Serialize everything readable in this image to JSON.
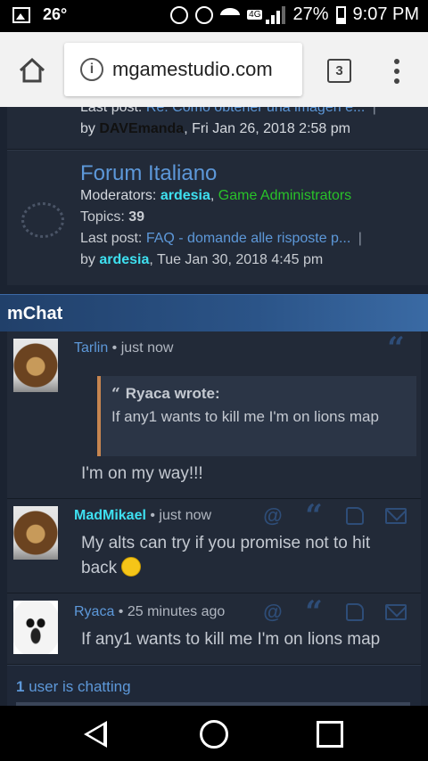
{
  "status_bar": {
    "temperature": "26°",
    "network": "4G",
    "battery": "27%",
    "time": "9:07 PM"
  },
  "browser": {
    "url": "mgamestudio.com",
    "tab_count": "3"
  },
  "forum": {
    "prev_row": {
      "last_post_label": "Last post:",
      "last_post_title": "Re: Como obtener una imagen e...",
      "separator": "|",
      "by_label": "by",
      "author": "DAVEmanda",
      "date": ", Fri Jan 26, 2018 2:58 pm"
    },
    "italiano": {
      "title": "Forum Italiano",
      "moderators_label": "Moderators:",
      "moderator_1": "ardesia",
      "comma": ",",
      "moderator_2": "Game Administrators",
      "topics_label": "Topics:",
      "topics_count": "39",
      "last_post_label": "Last post:",
      "last_post_title": "FAQ - domande alle risposte p...",
      "separator": "|",
      "by_label": "by",
      "author": "ardesia",
      "date": ", Tue Jan 30, 2018 4:45 pm"
    }
  },
  "mchat": {
    "title": "mChat",
    "messages": [
      {
        "user": "Tarlin",
        "time": " • just now",
        "quote": {
          "header": "Ryaca wrote:",
          "text": "If any1 wants to kill me I'm on lions map"
        },
        "text": "I'm on my way!!!"
      },
      {
        "user": "MadMikael",
        "time": " • just now",
        "text_line1": "My alts can try if you promise not to hit",
        "text_line2": "back"
      },
      {
        "user": "Ryaca",
        "time": " • 25 minutes ago",
        "text": "If any1 wants to kill me I'm on lions map"
      }
    ],
    "users_count": "1",
    "users_label": "user is chatting"
  },
  "icons": {
    "quote": "quote-icon",
    "mention": "at-icon",
    "like": "thumbs-up-icon",
    "pm": "envelope-icon"
  },
  "colors": {
    "link": "#5d98d9",
    "moderator": "#3ee0f0",
    "admin_group": "#29c229",
    "header": "#2b5488"
  }
}
